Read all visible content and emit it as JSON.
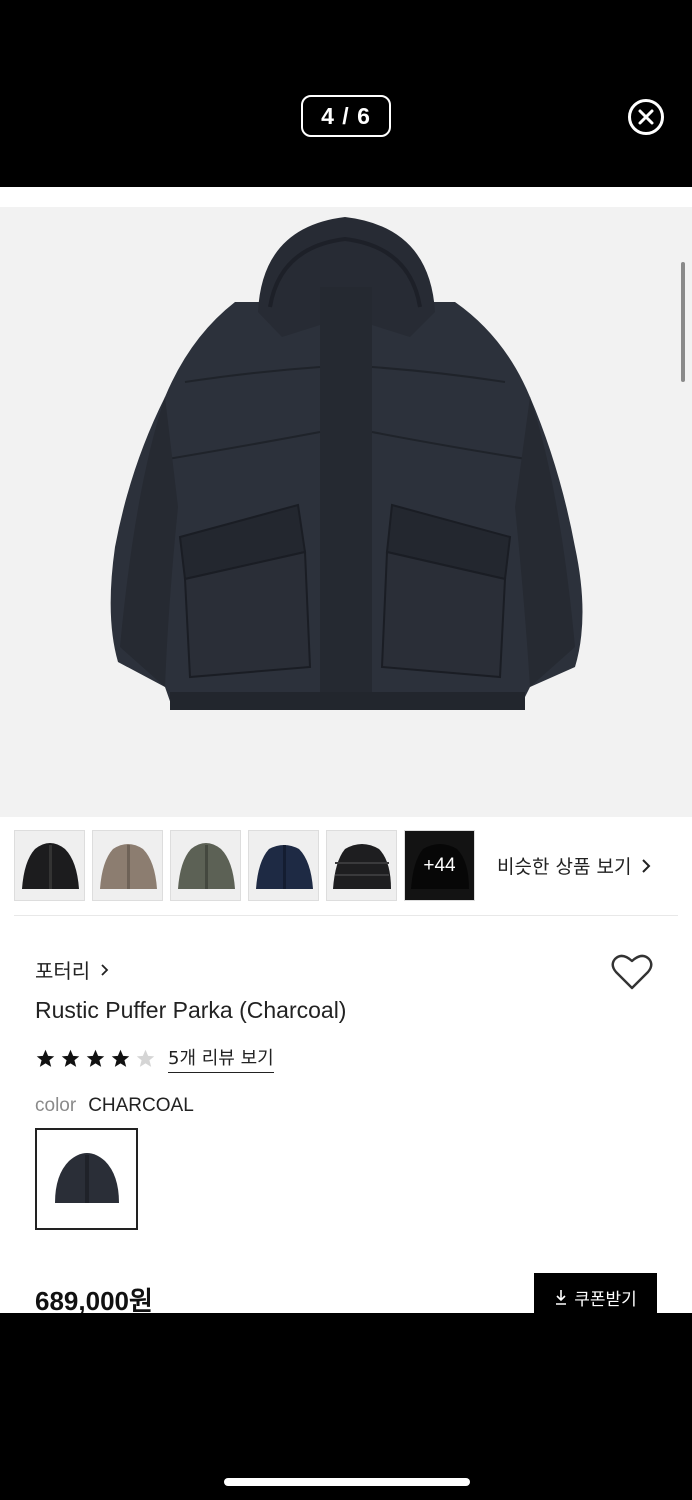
{
  "viewer": {
    "counter": "4 / 6"
  },
  "thumbnails": [
    {
      "name": "black-puffer"
    },
    {
      "name": "beige-puffer"
    },
    {
      "name": "khaki-puffer"
    },
    {
      "name": "navy-puffer"
    },
    {
      "name": "black-down-puffer"
    },
    {
      "name": "more-thumbnail",
      "label": "+44"
    }
  ],
  "similar_link": "비슷한 상품 보기",
  "product": {
    "brand": "포터리",
    "title": "Rustic Puffer Parka (Charcoal)",
    "rating": 4,
    "rating_max": 5,
    "review_link": "5개 리뷰 보기",
    "color_label": "color",
    "color_value": "CHARCOAL",
    "price": "689,000원",
    "coupon_button": "쿠폰받기"
  },
  "colors": {
    "jacket": "#2a2e37",
    "accent": "#000000"
  }
}
